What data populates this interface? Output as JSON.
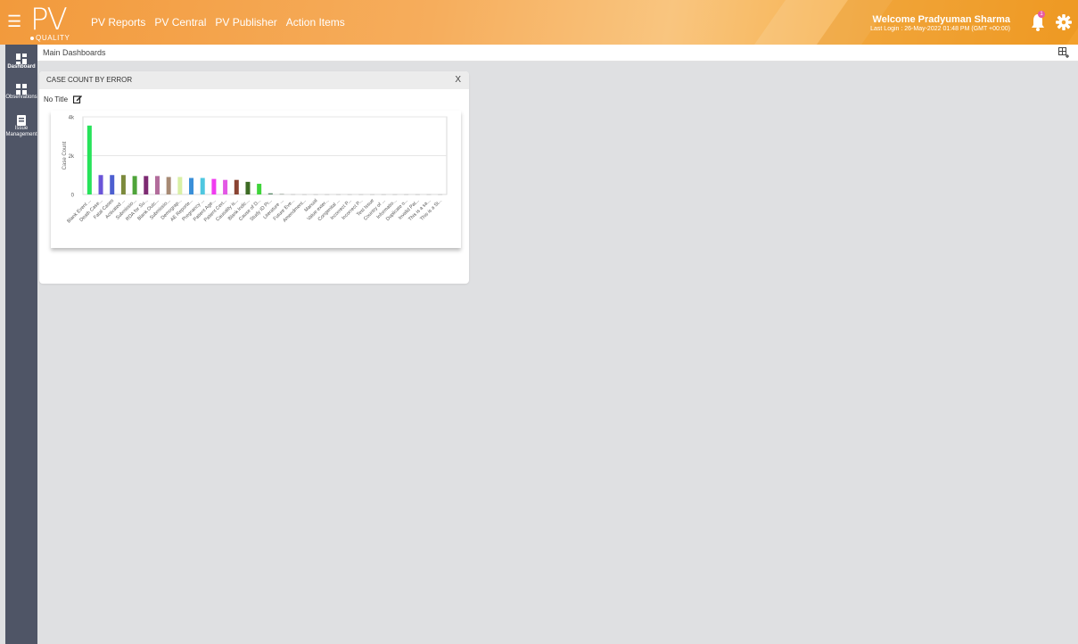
{
  "header": {
    "logo_text": "PV",
    "logo_sub": "QUALITY",
    "nav": [
      "PV Reports",
      "PV Central",
      "PV Publisher",
      "Action Items"
    ],
    "welcome": "Welcome Pradyuman Sharma",
    "last_login": "Last Login : 26-May-2022 01:48 PM (GMT +00:00)",
    "notification_count": "1",
    "icons": {
      "menu": "hamburger-icon",
      "bell": "bell-icon",
      "settings": "gear-icon"
    }
  },
  "sidebar": {
    "items": [
      {
        "label": "Dashboard",
        "icon": "dashboard-icon"
      },
      {
        "label": "Observations",
        "icon": "observations-icon"
      },
      {
        "label": "Issue Management",
        "icon": "issue-icon"
      }
    ]
  },
  "breadcrumb": "Main Dashboards",
  "widget": {
    "title": "CASE COUNT BY ERROR",
    "close": "X",
    "subtitle": "No Title"
  },
  "chart_data": {
    "type": "bar",
    "ylabel": "Case Count",
    "ylim": [
      0,
      4000
    ],
    "yticks": [
      "0",
      "2k",
      "4k"
    ],
    "grid": true,
    "categories": [
      "Blank Event ...",
      "Death Case...",
      "Fatal Cases",
      "Activated ...",
      "Submissio...",
      "RDA for Su...",
      "Blank Outc...",
      "Submissio...",
      "Demograp...",
      "AE Reporte...",
      "Pregnancy ...",
      "Patient Age...",
      "Patient Cert...",
      "Causality is...",
      "Blank Indic...",
      "Cause of D...",
      "Study ID Pr...",
      "Literature ...",
      "Future Eve...",
      "Amendment...",
      "Manual",
      "Value exter...",
      "Congenital ...",
      "Incorrect P...",
      "Incorrect P...",
      "Test Issue",
      "Country of ...",
      "Informatio...",
      "Duplicate o...",
      "Invalid Pat...",
      "This is a sa...",
      "This is a St..."
    ],
    "values": [
      3550,
      1000,
      1000,
      1000,
      950,
      950,
      950,
      900,
      900,
      850,
      850,
      800,
      750,
      750,
      650,
      550,
      60,
      20,
      10,
      5,
      5,
      5,
      5,
      5,
      5,
      5,
      5,
      5,
      5,
      5,
      5,
      5
    ],
    "colors": [
      "#27e35a",
      "#6a55d8",
      "#4d5fd0",
      "#7c8a3c",
      "#4fa43a",
      "#7d2a72",
      "#b26c9b",
      "#a78a74",
      "#d9f0a5",
      "#3a8fd8",
      "#4ec7e0",
      "#f03cf0",
      "#e358e5",
      "#8a4332",
      "#3d6b24",
      "#3fd43a",
      "#5b8a6a",
      "#6e7d6e",
      "#aaaaaa",
      "#aaaaaa",
      "#aaaaaa",
      "#aaaaaa",
      "#aaaaaa",
      "#aaaaaa",
      "#aaaaaa",
      "#aaaaaa",
      "#aaaaaa",
      "#aaaaaa",
      "#aaaaaa",
      "#aaaaaa",
      "#aaaaaa",
      "#aaaaaa"
    ]
  }
}
